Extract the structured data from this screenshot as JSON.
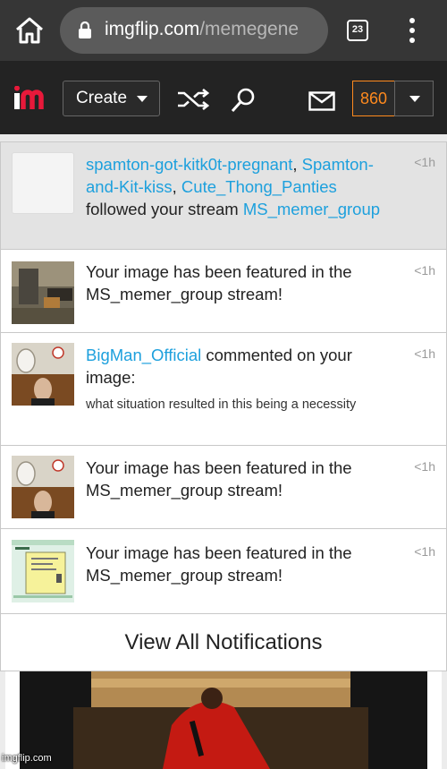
{
  "browser": {
    "url_host": "imgflip.com",
    "url_path": "/memegene",
    "tab_count": "23",
    "home_icon": "home-icon",
    "lock_icon": "lock-icon",
    "menu_icon": "kebab-menu-icon"
  },
  "header": {
    "create_label": "Create",
    "points": "860",
    "icons": [
      "imgflip-logo",
      "shuffle-icon",
      "search-icon",
      "mail-icon",
      "caret-down-icon"
    ],
    "accent": "#ff8a1e",
    "bg": "#232323"
  },
  "notifications": [
    {
      "users": [
        "spamton-got-kitk0t-pregnant",
        "Spamton-and-Kit-kiss",
        "Cute_Thong_Panties"
      ],
      "sep1": ",",
      "sep2": ",",
      "action": " followed your stream ",
      "stream": "MS_memer_group",
      "time": "<1h",
      "unread": true
    },
    {
      "text": "Your image has been featured in the MS_memer_group stream!",
      "time": "<1h"
    },
    {
      "user": "BigMan_Official",
      "action": " commented on your image:",
      "comment": "what situation resulted in this being a necessity",
      "time": "<1h"
    },
    {
      "text": "Your image has been featured in the MS_memer_group stream!",
      "time": "<1h"
    },
    {
      "text": "Your image has been featured in the MS_memer_group stream!",
      "time": "<1h"
    }
  ],
  "view_all_label": "View All Notifications",
  "watermark": "imgflip.com",
  "colors": {
    "link": "#1da0dd",
    "unread_bg": "#e3e3e3",
    "chrome_bg": "#363636"
  }
}
